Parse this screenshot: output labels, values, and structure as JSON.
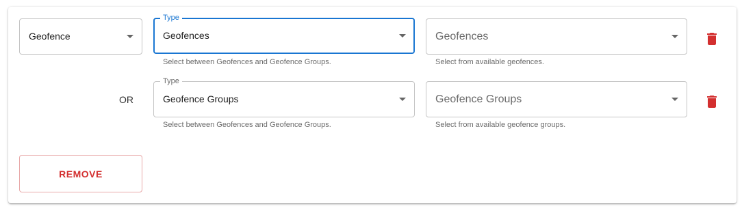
{
  "condition_select": {
    "value": "Geofence"
  },
  "rows": [
    {
      "type_label": "Type",
      "type_value": "Geofences",
      "type_helper": "Select between Geofences and Geofence Groups.",
      "item_placeholder": "Geofences",
      "item_helper": "Select from available geofences."
    },
    {
      "connector": "OR",
      "type_label": "Type",
      "type_value": "Geofence Groups",
      "type_helper": "Select between Geofences and Geofence Groups.",
      "item_placeholder": "Geofence Groups",
      "item_helper": "Select from available geofence groups."
    }
  ],
  "remove_button": {
    "label": "REMOVE"
  },
  "colors": {
    "accent": "#1976d2",
    "danger": "#d32f2f",
    "border": "#c4c4c4"
  },
  "icons": [
    "chevron-down-icon",
    "trash-icon"
  ]
}
